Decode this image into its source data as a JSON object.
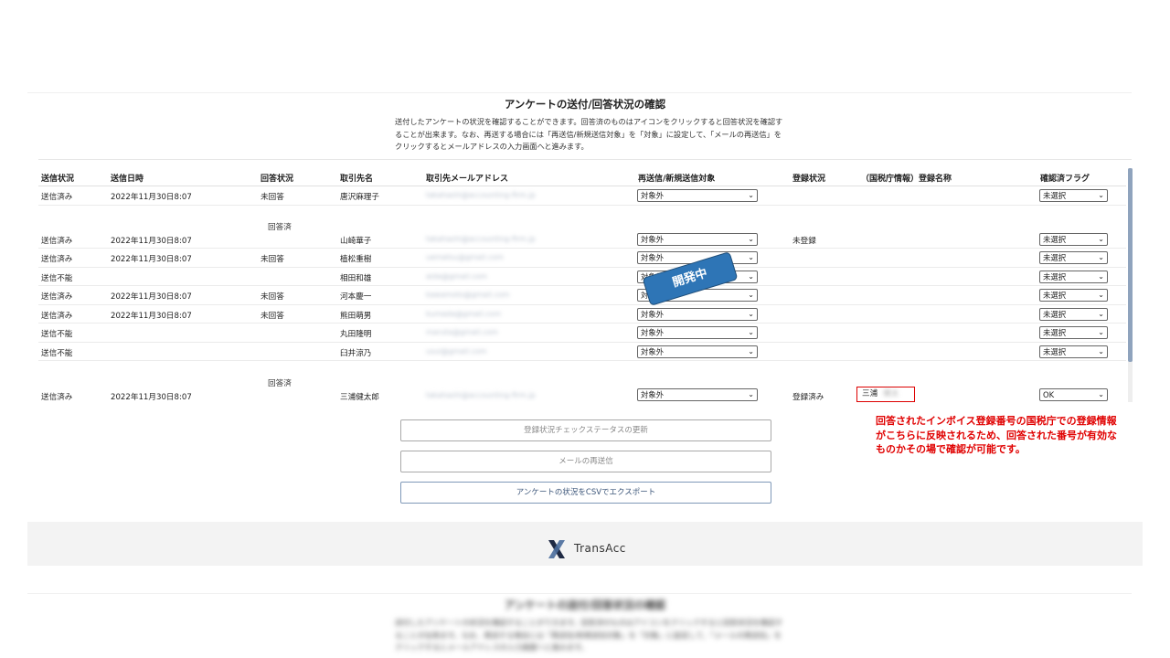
{
  "header": {
    "title": "アンケートの送付/回答状況の確認",
    "description": "送付したアンケートの状況を確認することができます。回答済のものはアイコンをクリックすると回答状況を確認することが出来ます。なお、再送する場合には「再送信/新規送信対象」を「対象」に設定して、「メールの再送信」をクリックするとメールアドレスの入力画面へと進みます。"
  },
  "table": {
    "columns": [
      "送信状況",
      "送信日時",
      "回答状況",
      "取引先名",
      "取引先メールアドレス",
      "再送信/新規送信対象",
      "登録状況",
      "（国税庁情報）登録名称",
      "確認済フラグ"
    ],
    "rows": [
      {
        "send_status": "送信済み",
        "sent_at": "2022年11月30日8:07",
        "answer": "未回答",
        "client": "唐沢麻理子",
        "email": "takahashi@accounting-firm.jp",
        "resend": "対象外",
        "reg_status": "",
        "reg_name": "",
        "flag": "未選択"
      },
      {
        "send_status": "送信済み",
        "sent_at": "2022年11月30日8:07",
        "answer": "回答済",
        "client": "山崎華子",
        "email": "takahashi@accounting-firm.jp",
        "resend": "対象外",
        "reg_status": "未登録",
        "reg_name": "",
        "flag": "未選択"
      },
      {
        "send_status": "送信済み",
        "sent_at": "2022年11月30日8:07",
        "answer": "未回答",
        "client": "植松重樹",
        "email": "uematsu@gmail.com",
        "resend": "対象外",
        "reg_status": "",
        "reg_name": "",
        "flag": "未選択"
      },
      {
        "send_status": "送信不能",
        "sent_at": "",
        "answer": "",
        "client": "相田和雄",
        "email": "aida@gmail.com",
        "resend": "対象外",
        "reg_status": "",
        "reg_name": "",
        "flag": "未選択"
      },
      {
        "send_status": "送信済み",
        "sent_at": "2022年11月30日8:07",
        "answer": "未回答",
        "client": "河本慶一",
        "email": "kawamoto@gmail.com",
        "resend": "対象外",
        "reg_status": "",
        "reg_name": "",
        "flag": "未選択"
      },
      {
        "send_status": "送信済み",
        "sent_at": "2022年11月30日8:07",
        "answer": "未回答",
        "client": "熊田萌男",
        "email": "kumada@gmail.com",
        "resend": "対象外",
        "reg_status": "",
        "reg_name": "",
        "flag": "未選択"
      },
      {
        "send_status": "送信不能",
        "sent_at": "",
        "answer": "",
        "client": "丸田隆明",
        "email": "maruta@gmail.com",
        "resend": "対象外",
        "reg_status": "",
        "reg_name": "",
        "flag": "未選択"
      },
      {
        "send_status": "送信不能",
        "sent_at": "",
        "answer": "",
        "client": "臼井涼乃",
        "email": "usui@gmail.com",
        "resend": "対象外",
        "reg_status": "",
        "reg_name": "",
        "flag": "未選択"
      },
      {
        "send_status": "送信済み",
        "sent_at": "2022年11月30日8:07",
        "answer": "回答済",
        "client": "三浦健太郎",
        "email": "takahashi@accounting-firm.jp",
        "resend": "対象外",
        "reg_status": "登録済み",
        "reg_name": "三浦",
        "reg_name_hidden": "健太",
        "flag": "OK"
      }
    ]
  },
  "badge": "開発中",
  "buttons": {
    "update": "登録状況チェックステータスの更新",
    "resend": "メールの再送信",
    "export": "アンケートの状況をCSVでエクスポート"
  },
  "note": "回答されたインボイス登録番号の国税庁での登録情報がこちらに反映されるため、回答された番号が有効なものかその場で確認が可能です。",
  "footer": {
    "brand": "TransAcc"
  },
  "colors": {
    "accent": "#2e75b6",
    "note": "#e00000",
    "scroll": "#8fa3bd"
  }
}
